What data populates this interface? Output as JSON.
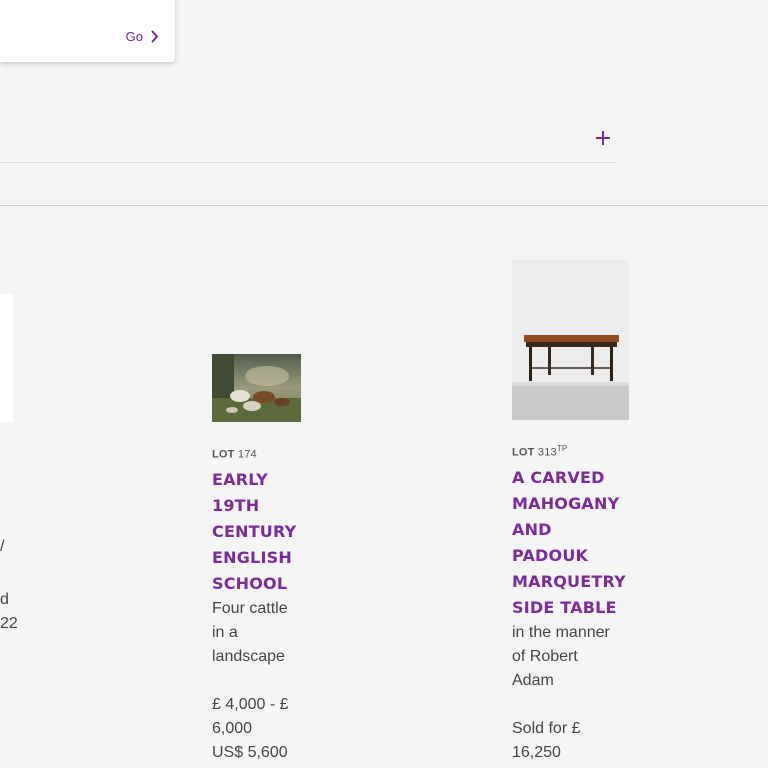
{
  "popup": {
    "go_label": "Go"
  },
  "partial_lot": {
    "fragment_1": "/",
    "fragment_2": "d",
    "fragment_3": "22"
  },
  "lots": [
    {
      "lot_label": "LOT",
      "lot_number": "174",
      "lot_suffix": "",
      "title_lines": [
        "EARLY",
        "19TH",
        "CENTURY",
        "ENGLISH",
        "SCHOOL"
      ],
      "description_lines": [
        "Four cattle",
        "in a",
        "landscape"
      ],
      "price_lines": [
        "£ 4,000 - £",
        "6,000",
        "US$ 5,600"
      ]
    },
    {
      "lot_label": "LOT",
      "lot_number": "313",
      "lot_suffix": "TP",
      "title_lines": [
        "A CARVED",
        "MAHOGANY",
        "AND",
        "PADOUK",
        "MARQUETRY",
        "SIDE TABLE"
      ],
      "description_lines": [
        "in the manner",
        "of Robert",
        "Adam"
      ],
      "price_lines": [
        "Sold for £",
        "16,250"
      ]
    }
  ],
  "colors": {
    "accent": "#7b2c98",
    "background": "#f5f5f5",
    "divider": "#cfcfcf"
  },
  "icons": [
    "chevron-right-icon",
    "plus-icon"
  ]
}
